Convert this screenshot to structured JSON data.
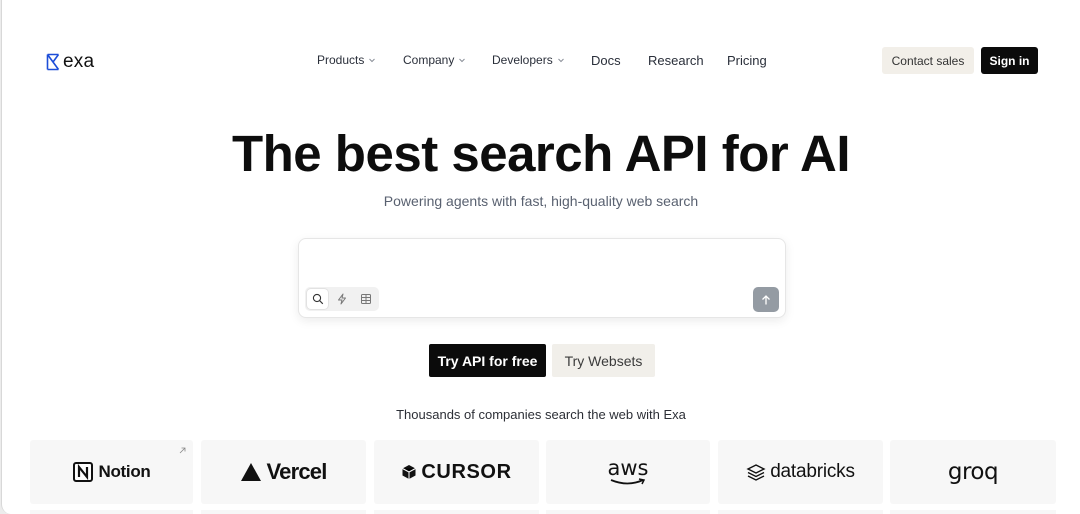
{
  "brand": {
    "name": "exa"
  },
  "nav": {
    "items": [
      {
        "label": "Products",
        "has_menu": true
      },
      {
        "label": "Company",
        "has_menu": true
      },
      {
        "label": "Developers",
        "has_menu": true
      },
      {
        "label": "Docs",
        "has_menu": false
      },
      {
        "label": "Research",
        "has_menu": false
      },
      {
        "label": "Pricing",
        "has_menu": false
      }
    ],
    "contact_label": "Contact sales",
    "signin_label": "Sign in"
  },
  "hero": {
    "title": "The best search API for AI",
    "subtitle": "Powering agents with fast, high-quality web search"
  },
  "search": {
    "value": "",
    "modes": [
      "search-icon",
      "lightning-icon",
      "table-icon"
    ],
    "active_mode": "search-icon",
    "submit_icon": "arrow-up-icon"
  },
  "cta": {
    "primary_label": "Try API for free",
    "secondary_label": "Try Websets"
  },
  "customers": {
    "caption": "Thousands of companies search the web with Exa",
    "logos": [
      {
        "name": "Notion"
      },
      {
        "name": "Vercel"
      },
      {
        "name": "CURSOR"
      },
      {
        "name": "aws"
      },
      {
        "name": "databricks"
      },
      {
        "name": "groq"
      }
    ]
  },
  "colors": {
    "accent_blue": "#1d4ed8",
    "primary_button": "#0b0b0b",
    "secondary_button": "#f1efea",
    "submit_button": "#949ba3"
  }
}
